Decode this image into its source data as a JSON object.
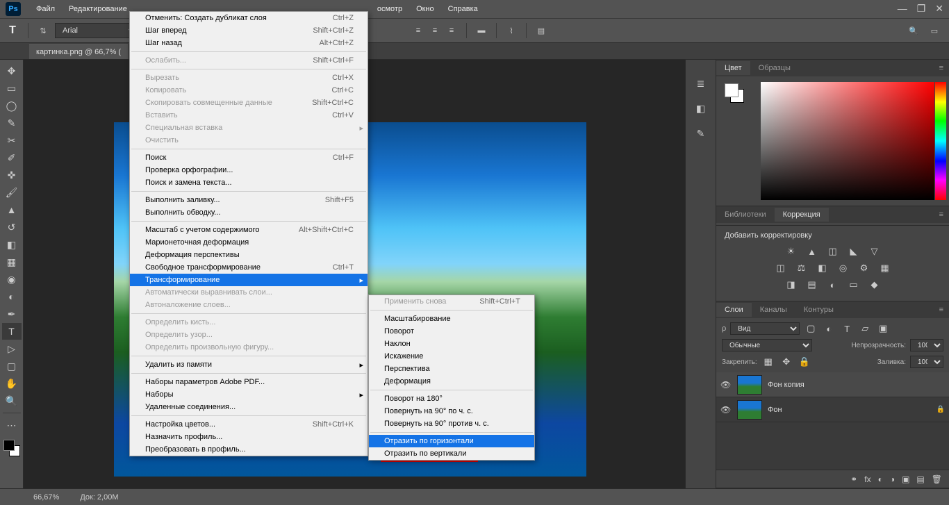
{
  "app": {
    "logo": "Ps"
  },
  "menubar": {
    "items": [
      "Файл",
      "Редактирование",
      "",
      "",
      "",
      "",
      "",
      "",
      "",
      "осмотр",
      "Окно",
      "Справка"
    ],
    "active_index": 1
  },
  "window_controls": {
    "min": "—",
    "max": "❐",
    "close": "✕"
  },
  "optionbar": {
    "tool_letter": "T",
    "font": "Arial"
  },
  "document": {
    "tab_title": "картинка.png @ 66,7% ("
  },
  "status": {
    "zoom": "66,67%",
    "doc_info": "Док: 2,00M"
  },
  "panels": {
    "color": {
      "tabs": [
        "Цвет",
        "Образцы"
      ],
      "active": 0
    },
    "libraries": {
      "tabs": [
        "Библиотеки",
        "Коррекция"
      ],
      "active": 1
    },
    "adjustments": {
      "title": "Добавить корректировку"
    },
    "layers": {
      "tabs": [
        "Слои",
        "Каналы",
        "Контуры"
      ],
      "active": 0,
      "filter_placeholder": "Вид",
      "blend_mode": "Обычные",
      "opacity_label": "Непрозрачность:",
      "opacity_value": "100%",
      "lock_label": "Закрепить:",
      "fill_label": "Заливка:",
      "fill_value": "100%",
      "items": [
        {
          "name": "Фон копия",
          "locked": false
        },
        {
          "name": "Фон",
          "locked": true
        }
      ]
    }
  },
  "edit_menu": {
    "groups": [
      [
        {
          "label": "Отменить: Создать дубликат слоя",
          "shortcut": "Ctrl+Z",
          "enabled": true
        },
        {
          "label": "Шаг вперед",
          "shortcut": "Shift+Ctrl+Z",
          "enabled": true
        },
        {
          "label": "Шаг назад",
          "shortcut": "Alt+Ctrl+Z",
          "enabled": true
        }
      ],
      [
        {
          "label": "Ослабить...",
          "shortcut": "Shift+Ctrl+F",
          "enabled": false
        }
      ],
      [
        {
          "label": "Вырезать",
          "shortcut": "Ctrl+X",
          "enabled": false
        },
        {
          "label": "Копировать",
          "shortcut": "Ctrl+C",
          "enabled": false
        },
        {
          "label": "Скопировать совмещенные данные",
          "shortcut": "Shift+Ctrl+C",
          "enabled": false
        },
        {
          "label": "Вставить",
          "shortcut": "Ctrl+V",
          "enabled": false
        },
        {
          "label": "Специальная вставка",
          "submenu": true,
          "enabled": false
        },
        {
          "label": "Очистить",
          "enabled": false
        }
      ],
      [
        {
          "label": "Поиск",
          "shortcut": "Ctrl+F",
          "enabled": true
        },
        {
          "label": "Проверка орфографии...",
          "enabled": true
        },
        {
          "label": "Поиск и замена текста...",
          "enabled": true
        }
      ],
      [
        {
          "label": "Выполнить заливку...",
          "shortcut": "Shift+F5",
          "enabled": true
        },
        {
          "label": "Выполнить обводку...",
          "enabled": true
        }
      ],
      [
        {
          "label": "Масштаб с учетом содержимого",
          "shortcut": "Alt+Shift+Ctrl+C",
          "enabled": true
        },
        {
          "label": "Марионеточная деформация",
          "enabled": true
        },
        {
          "label": "Деформация перспективы",
          "enabled": true
        },
        {
          "label": "Свободное трансформирование",
          "shortcut": "Ctrl+T",
          "enabled": true
        },
        {
          "label": "Трансформирование",
          "submenu": true,
          "enabled": true,
          "highlighted": true
        },
        {
          "label": "Автоматически выравнивать слои...",
          "enabled": false
        },
        {
          "label": "Автоналожение слоев...",
          "enabled": false
        }
      ],
      [
        {
          "label": "Определить кисть...",
          "enabled": false
        },
        {
          "label": "Определить узор...",
          "enabled": false
        },
        {
          "label": "Определить произвольную фигуру...",
          "enabled": false
        }
      ],
      [
        {
          "label": "Удалить из памяти",
          "submenu": true,
          "enabled": true
        }
      ],
      [
        {
          "label": "Наборы параметров Adobe PDF...",
          "enabled": true
        },
        {
          "label": "Наборы",
          "submenu": true,
          "enabled": true
        },
        {
          "label": "Удаленные соединения...",
          "enabled": true
        }
      ],
      [
        {
          "label": "Настройка цветов...",
          "shortcut": "Shift+Ctrl+K",
          "enabled": true
        },
        {
          "label": "Назначить профиль...",
          "enabled": true
        },
        {
          "label": "Преобразовать в профиль...",
          "enabled": true
        }
      ]
    ]
  },
  "transform_menu": {
    "groups": [
      [
        {
          "label": "Применить снова",
          "shortcut": "Shift+Ctrl+T",
          "enabled": false
        }
      ],
      [
        {
          "label": "Масштабирование",
          "enabled": true
        },
        {
          "label": "Поворот",
          "enabled": true
        },
        {
          "label": "Наклон",
          "enabled": true
        },
        {
          "label": "Искажение",
          "enabled": true
        },
        {
          "label": "Перспектива",
          "enabled": true
        },
        {
          "label": "Деформация",
          "enabled": true
        }
      ],
      [
        {
          "label": "Поворот на 180°",
          "enabled": true
        },
        {
          "label": "Повернуть на 90° по ч. с.",
          "enabled": true
        },
        {
          "label": "Повернуть на 90° против ч. с.",
          "enabled": true
        }
      ],
      [
        {
          "label": "Отразить по горизонтали",
          "enabled": true,
          "highlighted": true
        },
        {
          "label": "Отразить по вертикали",
          "enabled": true
        }
      ]
    ]
  }
}
